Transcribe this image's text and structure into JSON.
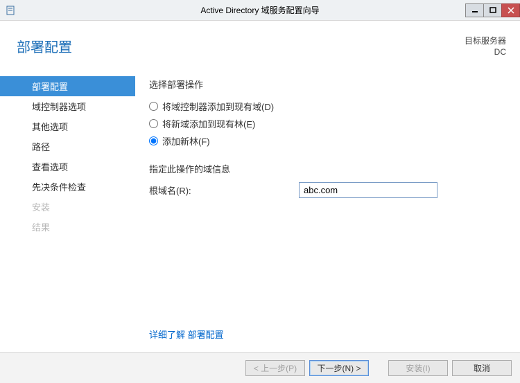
{
  "titlebar": {
    "title": "Active Directory 域服务配置向导"
  },
  "header": {
    "page_title": "部署配置",
    "target_label": "目标服务器",
    "target_value": "DC"
  },
  "nav": {
    "items": [
      {
        "label": "部署配置",
        "state": "selected"
      },
      {
        "label": "域控制器选项",
        "state": "normal"
      },
      {
        "label": "其他选项",
        "state": "normal"
      },
      {
        "label": "路径",
        "state": "normal"
      },
      {
        "label": "查看选项",
        "state": "normal"
      },
      {
        "label": "先决条件检查",
        "state": "normal"
      },
      {
        "label": "安装",
        "state": "disabled"
      },
      {
        "label": "结果",
        "state": "disabled"
      }
    ]
  },
  "content": {
    "select_op_label": "选择部署操作",
    "radios": [
      {
        "label": "将域控制器添加到现有域(D)",
        "checked": false
      },
      {
        "label": "将新域添加到现有林(E)",
        "checked": false
      },
      {
        "label": "添加新林(F)",
        "checked": true
      }
    ],
    "domain_info_label": "指定此操作的域信息",
    "root_domain_label": "根域名(R):",
    "root_domain_value": "abc.com",
    "more_prefix": "详细了解",
    "more_link": "部署配置"
  },
  "footer": {
    "prev": "< 上一步(P)",
    "next": "下一步(N) >",
    "install": "安装(I)",
    "cancel": "取消"
  }
}
